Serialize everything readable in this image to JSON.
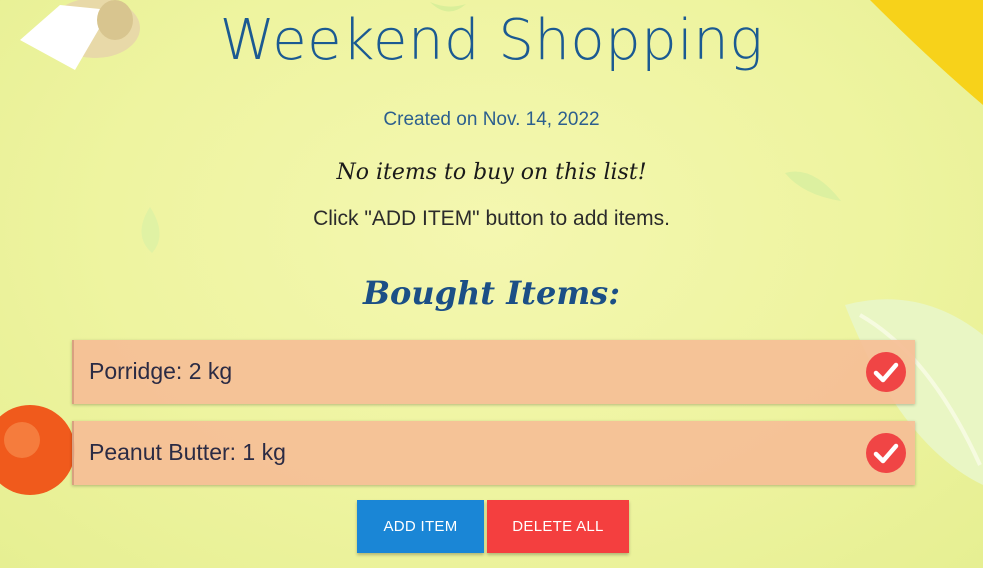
{
  "list": {
    "title": "Weekend Shopping",
    "created": "Created on Nov. 14, 2022",
    "empty_message": "No items to buy on this list!",
    "hint": "Click \"ADD ITEM\" button to add items."
  },
  "bought": {
    "heading": "Bought Items:",
    "items": [
      {
        "label": "Porridge: 2 kg"
      },
      {
        "label": "Peanut Butter: 1 kg"
      }
    ]
  },
  "actions": {
    "add_label": "ADD ITEM",
    "delete_all_label": "DELETE ALL"
  },
  "colors": {
    "accent_blue": "#1a86d6",
    "danger_red": "#f43f3f",
    "item_bg": "#f5be96",
    "title": "#1b5a92"
  },
  "icons": {
    "item_check": "check-circle-icon"
  }
}
